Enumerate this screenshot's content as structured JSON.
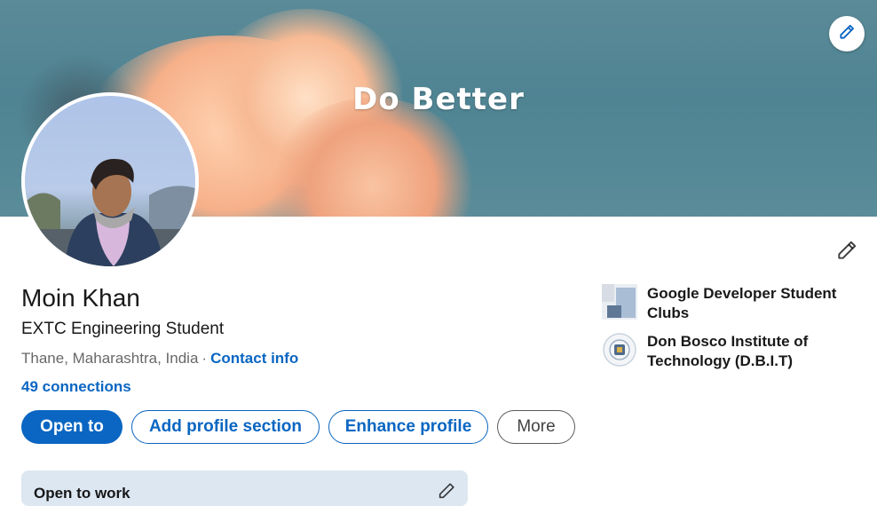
{
  "banner": {
    "text": "Do Better",
    "edit_icon": "pencil-icon",
    "sky_color": "#4f8493",
    "cloud_color": "#f7b995"
  },
  "profile": {
    "name": "Moin Khan",
    "headline": "EXTC Engineering Student",
    "location": "Thane, Maharashtra, India",
    "separator": "·",
    "contact_info": "Contact info",
    "connections": "49 connections"
  },
  "actions": {
    "open_to": "Open to",
    "add_section": "Add profile section",
    "enhance": "Enhance profile",
    "more": "More"
  },
  "organizations": [
    {
      "name": "Google Developer Student Clubs",
      "logo_icon": "google-dsc-logo"
    },
    {
      "name": "Don Bosco Institute of Technology (D.B.I.T)",
      "logo_icon": "dbit-logo"
    }
  ],
  "open_to_work": {
    "title": "Open to work",
    "edit_icon": "pencil-icon"
  },
  "colors": {
    "accent": "#0a66c2",
    "card_bg": "#dde7f1"
  }
}
